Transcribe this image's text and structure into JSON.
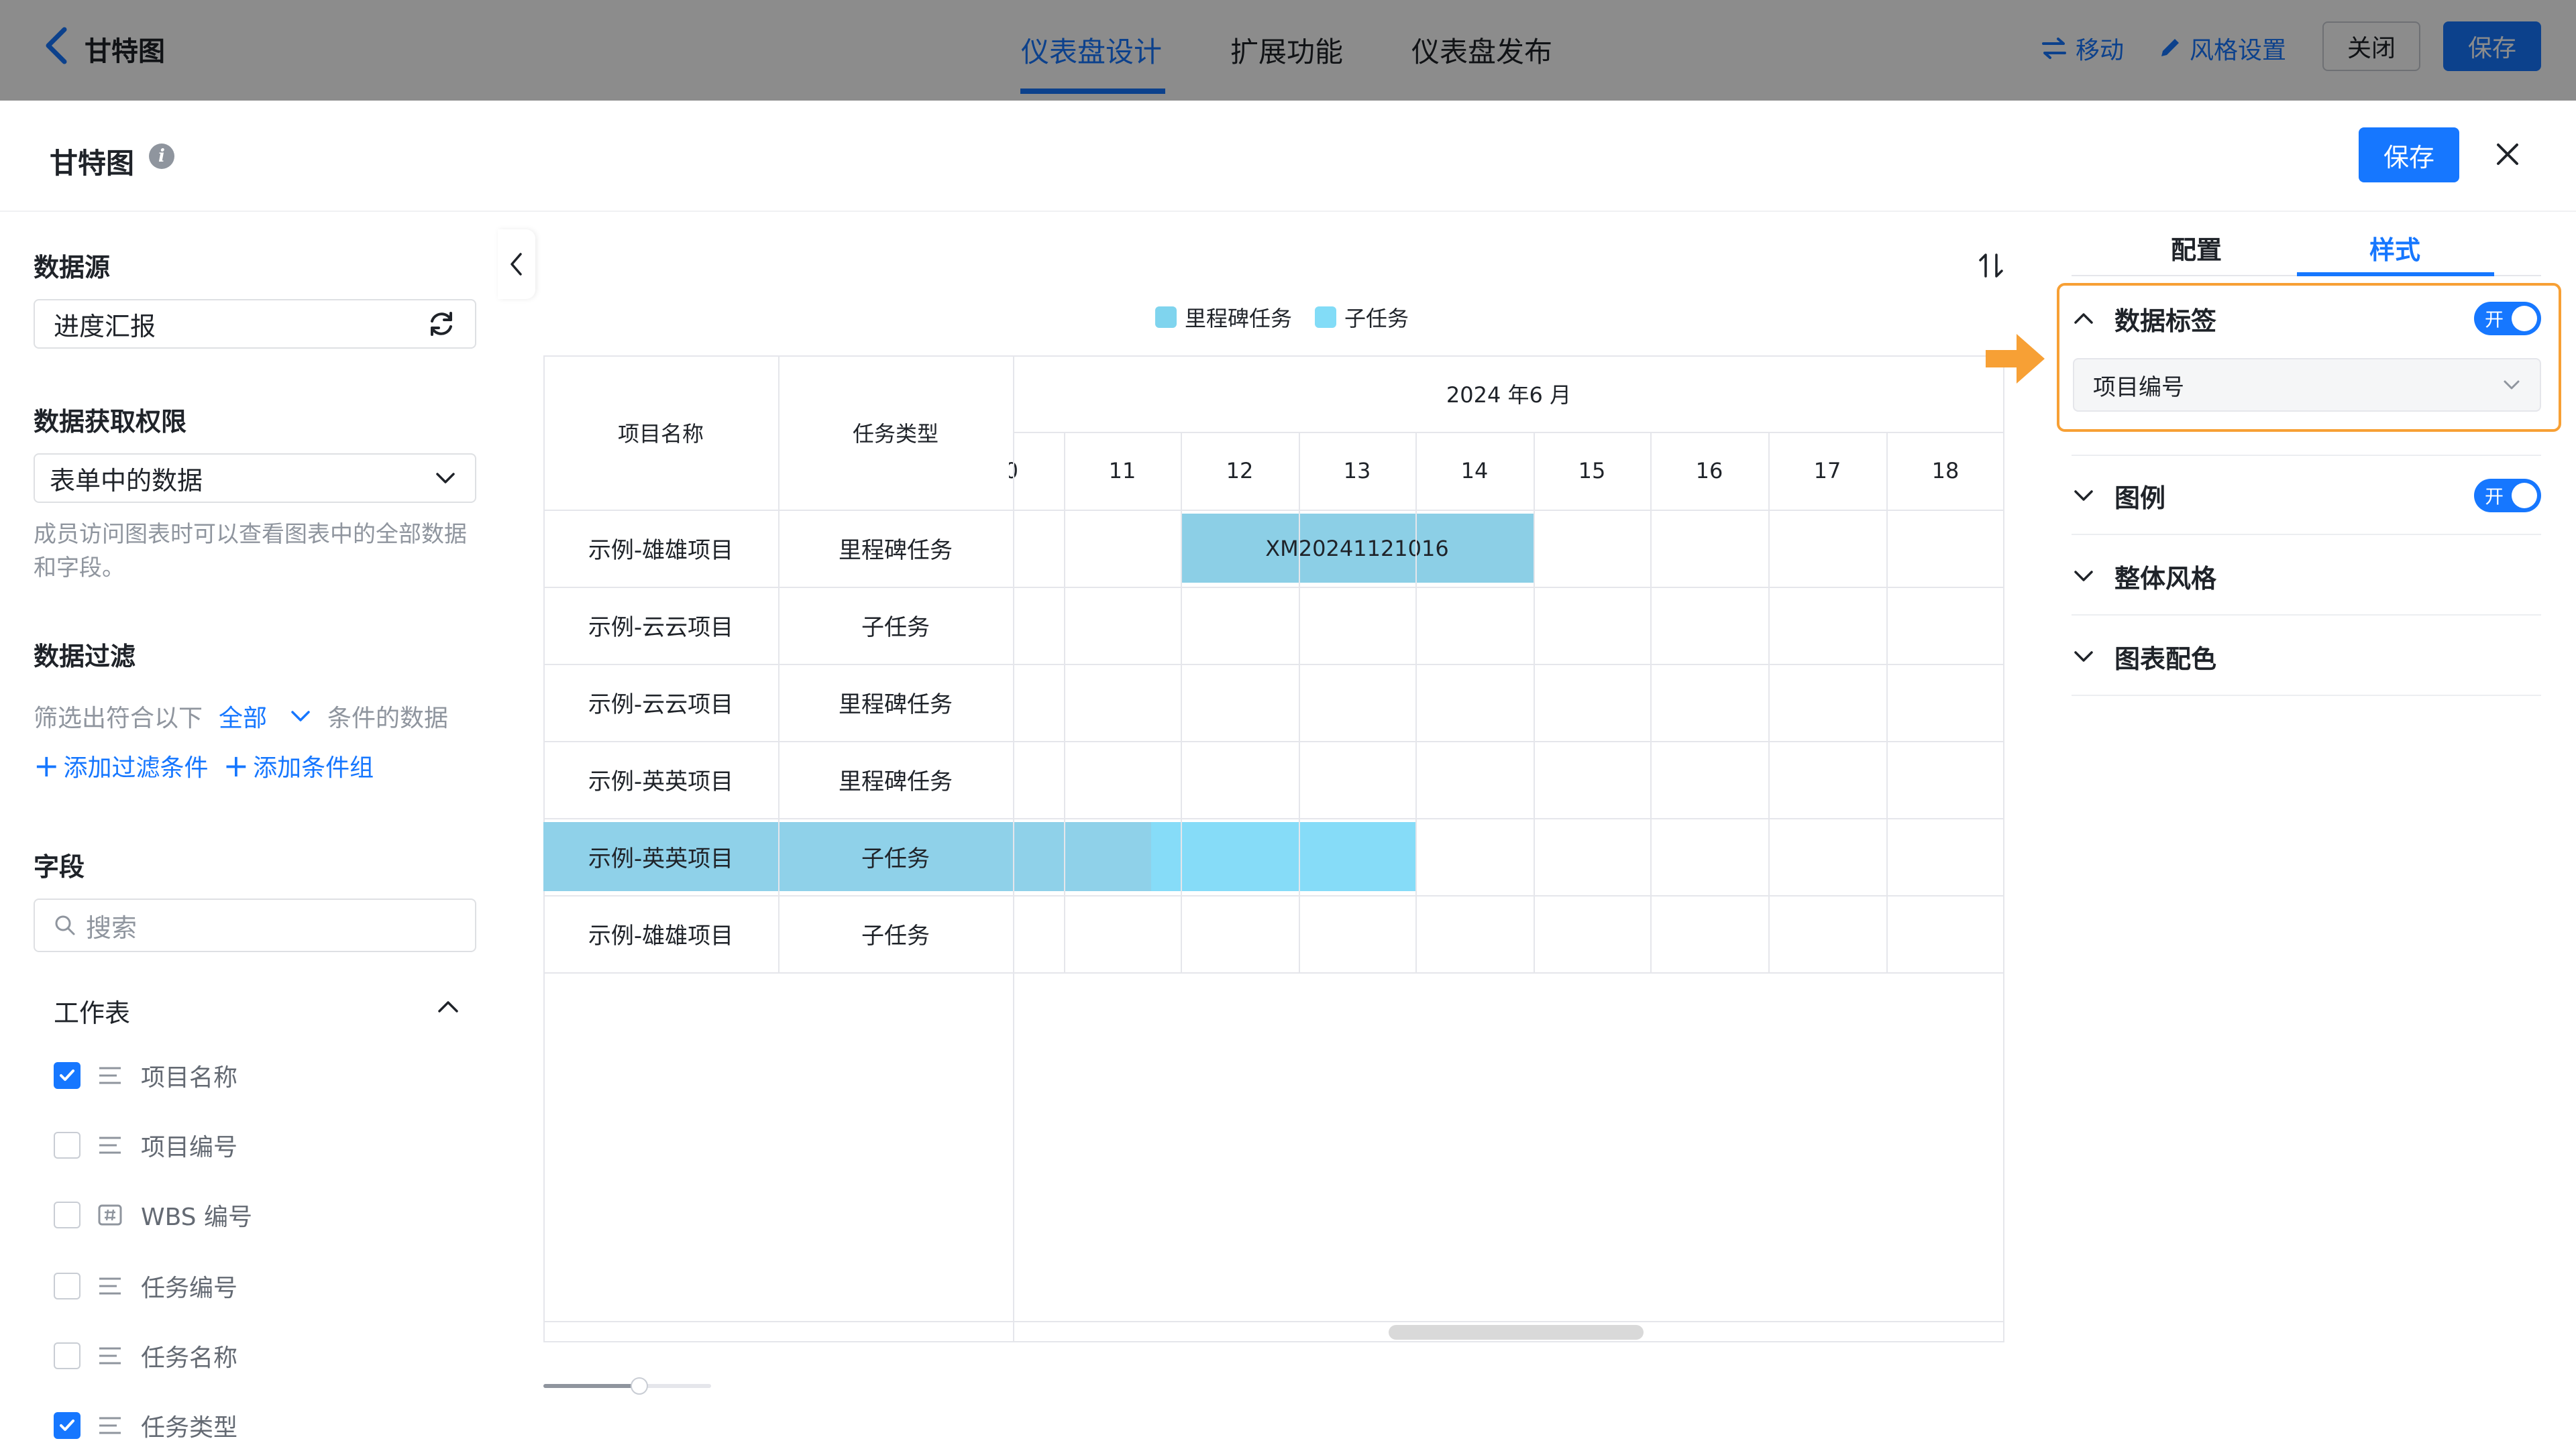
{
  "topbar": {
    "title": "甘特图",
    "tabs": [
      "仪表盘设计",
      "扩展功能",
      "仪表盘发布"
    ],
    "move_label": "移动",
    "style_label": "风格设置",
    "close_label": "关闭",
    "save_label": "保存"
  },
  "modal": {
    "title": "甘特图",
    "info_glyph": "i",
    "save_label": "保存"
  },
  "left": {
    "datasource_title": "数据源",
    "datasource_value": "进度汇报",
    "permission_title": "数据获取权限",
    "permission_value": "表单中的数据",
    "permission_hint": "成员访问图表时可以查看图表中的全部数据和字段。",
    "filter_title": "数据过滤",
    "filter_prefix": "筛选出符合以下",
    "filter_mode": "全部",
    "filter_suffix": "条件的数据",
    "add_filter": "添加过滤条件",
    "add_group": "添加条件组",
    "fields_title": "字段",
    "search_placeholder": "搜索",
    "worksheet_label": "工作表",
    "fields": [
      {
        "label": "项目名称",
        "checked": true,
        "icon": "text-icon"
      },
      {
        "label": "项目编号",
        "checked": false,
        "icon": "text-icon"
      },
      {
        "label": "WBS 编号",
        "checked": false,
        "icon": "number-icon"
      },
      {
        "label": "任务编号",
        "checked": false,
        "icon": "text-icon"
      },
      {
        "label": "任务名称",
        "checked": false,
        "icon": "text-icon"
      },
      {
        "label": "任务类型",
        "checked": true,
        "icon": "text-icon"
      }
    ]
  },
  "gantt": {
    "legend": [
      {
        "label": "里程碑任务",
        "color": "#7fd4ee"
      },
      {
        "label": "子任务",
        "color": "#82dcf7"
      }
    ],
    "col_project": "项目名称",
    "col_type": "任务类型",
    "month_label": "2024 年6 月",
    "days": [
      "11",
      "12",
      "13",
      "14",
      "15",
      "16",
      "17",
      "18"
    ],
    "partial_day": "0",
    "rows": [
      {
        "project": "示例-雄雄项目",
        "type": "里程碑任务"
      },
      {
        "project": "示例-云云项目",
        "type": "子任务"
      },
      {
        "project": "示例-云云项目",
        "type": "里程碑任务"
      },
      {
        "project": "示例-英英项目",
        "type": "里程碑任务"
      },
      {
        "project": "示例-英英项目",
        "type": "子任务"
      },
      {
        "project": "示例-雄雄项目",
        "type": "子任务"
      }
    ],
    "bar_label": "XM20241121016",
    "bar_colors": {
      "milestone": "#8ccfe6",
      "sub_a": "#8fd1e9",
      "sub_b": "#86dcf8"
    }
  },
  "right": {
    "tabs": [
      "配置",
      "样式"
    ],
    "data_label_title": "数据标签",
    "toggle_on": "开",
    "data_label_value": "项目编号",
    "legend_title": "图例",
    "overall_style_title": "整体风格",
    "chart_color_title": "图表配色",
    "highlight_color": "#f7a035"
  }
}
